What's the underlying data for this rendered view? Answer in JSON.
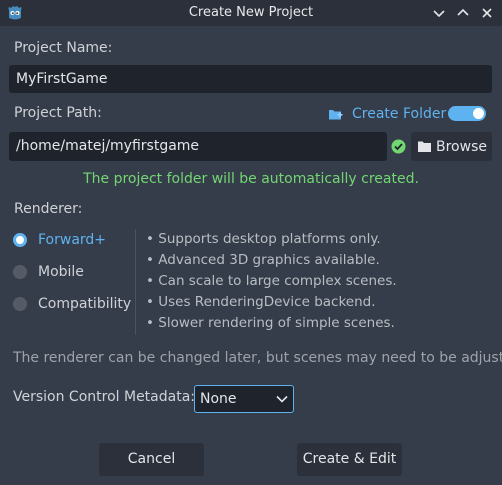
{
  "window": {
    "title": "Create New Project",
    "controls": [
      "minimize",
      "maximize",
      "close"
    ]
  },
  "project": {
    "name_label": "Project Name:",
    "name_value": "MyFirstGame",
    "path_label": "Project Path:",
    "path_value": "/home/matej/myfirstgame",
    "create_folder_label": "Create Folder",
    "create_folder_enabled": true,
    "browse_label": "Browse",
    "status_message": "The project folder will be automatically created."
  },
  "renderer": {
    "label": "Renderer:",
    "options": [
      {
        "label": "Forward+",
        "selected": true
      },
      {
        "label": "Mobile",
        "selected": false
      },
      {
        "label": "Compatibility",
        "selected": false
      }
    ],
    "features": [
      "• Supports desktop platforms only.",
      "• Advanced 3D graphics available.",
      "• Can scale to large complex scenes.",
      "• Uses RenderingDevice backend.",
      "• Slower rendering of simple scenes."
    ],
    "note": "The renderer can be changed later, but scenes may need to be adjusted."
  },
  "version_control": {
    "label": "Version Control Metadata:",
    "selected": "None"
  },
  "buttons": {
    "cancel": "Cancel",
    "create_edit": "Create & Edit"
  },
  "colors": {
    "accent": "#5fb2f0",
    "success": "#72d672",
    "background": "#363d4a",
    "titlebar": "#2b303a"
  }
}
